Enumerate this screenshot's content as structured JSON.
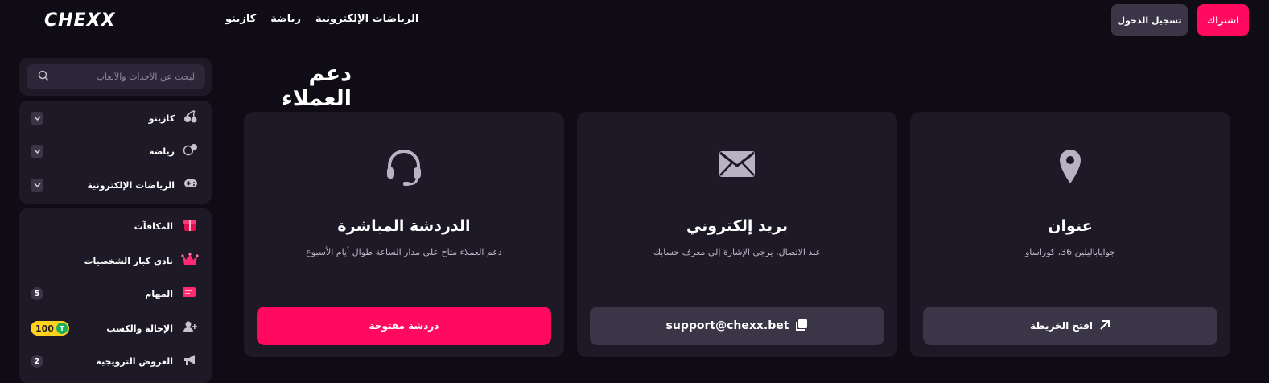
{
  "header": {
    "logo": "CHEXX",
    "nav": [
      "الرياضات الإلكترونية",
      "رياضة",
      "كازينو"
    ],
    "login_label": "تسجيل الدخول",
    "signup_label": "اشتراك"
  },
  "sidebar": {
    "search_placeholder": "البحث عن الأحداث والألعاب",
    "categories": [
      {
        "label": "كازينو",
        "icon": "cherries-icon"
      },
      {
        "label": "رياضة",
        "icon": "sports-icon"
      },
      {
        "label": "الرياضات الإلكترونية",
        "icon": "gamepad-icon"
      }
    ],
    "menu": [
      {
        "label": "المكافآت",
        "icon": "gift-icon"
      },
      {
        "label": "نادي كبار الشخصيات",
        "icon": "crown-icon"
      },
      {
        "label": "المهام",
        "icon": "tasks-icon",
        "badge": "5"
      },
      {
        "label": "الإحالة والكسب",
        "icon": "add-user-icon",
        "badge": "100",
        "badge_coin": "T"
      },
      {
        "label": "العروض الترويجية",
        "icon": "megaphone-icon",
        "badge": "2"
      }
    ]
  },
  "main": {
    "title": "دعم العملاء",
    "cards": [
      {
        "title": "الدردشة المباشرة",
        "desc": "دعم العملاء متاح على مدار الساعة طوال أيام الأسبوع",
        "button": "دردشة مفتوحة",
        "icon": "headset-icon",
        "button_icon": ""
      },
      {
        "title": "بريد إلكتروني",
        "desc": "عند الاتصال، يرجى الإشارة إلى معرف حسابك",
        "button": "support@chexx.bet",
        "icon": "envelope-icon",
        "button_icon": "copy-icon"
      },
      {
        "title": "عنوان",
        "desc": "جواياباليلين 36، كوراساو",
        "button": "افتح الخريطة",
        "icon": "map-pin-icon",
        "button_icon": "arrow-up-right-icon"
      }
    ]
  },
  "colors": {
    "background": "#0f0c15",
    "panel": "#1d1926",
    "accent": "#ff0a5f",
    "secondary_button": "#3b3548"
  }
}
